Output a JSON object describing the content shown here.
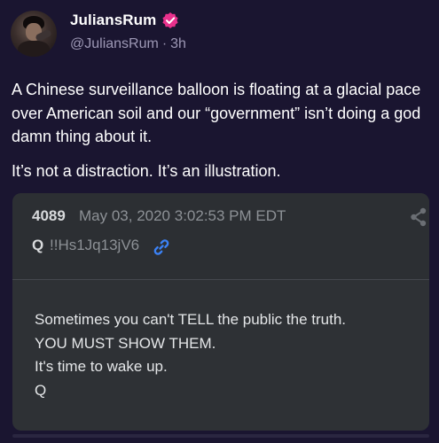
{
  "author": {
    "display_name": "JuliansRum",
    "handle": "@JuliansRum",
    "separator": "·",
    "time_ago": "3h",
    "verified": true,
    "verified_color": "#e8308c"
  },
  "post": {
    "paragraphs": [
      "A Chinese surveillance balloon is floating at a glacial pace over American soil and our “government” isn’t doing a god damn thing about it.",
      "It’s not a distraction. It’s an illustration."
    ]
  },
  "embed": {
    "post_number": "4089",
    "date": "May 03, 2020 3:02:53 PM EDT",
    "author": "Q",
    "tripcode": "!!Hs1Jq13jV6",
    "link_icon": "link-icon",
    "share_icon": "share-icon",
    "link_color": "#3b82f6",
    "lines": [
      "Sometimes you can't TELL the public the truth.",
      "YOU MUST SHOW THEM.",
      "It's time to wake up.",
      "Q"
    ]
  }
}
